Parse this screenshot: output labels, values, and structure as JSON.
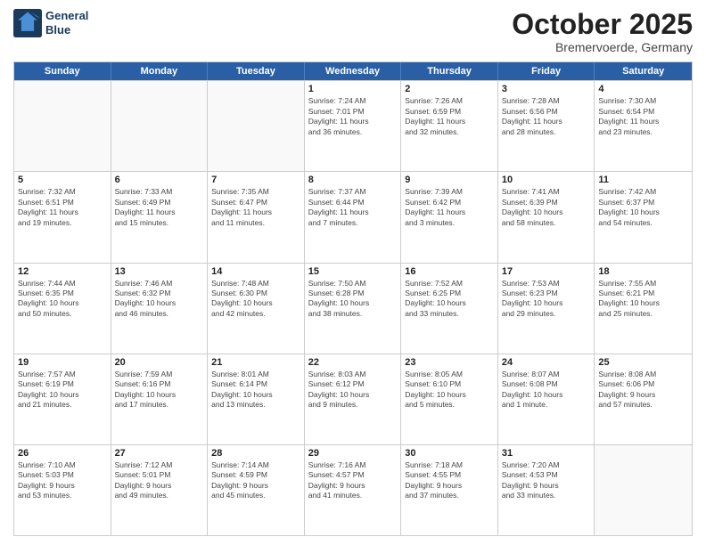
{
  "logo": {
    "line1": "General",
    "line2": "Blue"
  },
  "title": "October 2025",
  "subtitle": "Bremervoerde, Germany",
  "weekdays": [
    "Sunday",
    "Monday",
    "Tuesday",
    "Wednesday",
    "Thursday",
    "Friday",
    "Saturday"
  ],
  "rows": [
    [
      {
        "day": "",
        "info": ""
      },
      {
        "day": "",
        "info": ""
      },
      {
        "day": "",
        "info": ""
      },
      {
        "day": "1",
        "info": "Sunrise: 7:24 AM\nSunset: 7:01 PM\nDaylight: 11 hours\nand 36 minutes."
      },
      {
        "day": "2",
        "info": "Sunrise: 7:26 AM\nSunset: 6:59 PM\nDaylight: 11 hours\nand 32 minutes."
      },
      {
        "day": "3",
        "info": "Sunrise: 7:28 AM\nSunset: 6:56 PM\nDaylight: 11 hours\nand 28 minutes."
      },
      {
        "day": "4",
        "info": "Sunrise: 7:30 AM\nSunset: 6:54 PM\nDaylight: 11 hours\nand 23 minutes."
      }
    ],
    [
      {
        "day": "5",
        "info": "Sunrise: 7:32 AM\nSunset: 6:51 PM\nDaylight: 11 hours\nand 19 minutes."
      },
      {
        "day": "6",
        "info": "Sunrise: 7:33 AM\nSunset: 6:49 PM\nDaylight: 11 hours\nand 15 minutes."
      },
      {
        "day": "7",
        "info": "Sunrise: 7:35 AM\nSunset: 6:47 PM\nDaylight: 11 hours\nand 11 minutes."
      },
      {
        "day": "8",
        "info": "Sunrise: 7:37 AM\nSunset: 6:44 PM\nDaylight: 11 hours\nand 7 minutes."
      },
      {
        "day": "9",
        "info": "Sunrise: 7:39 AM\nSunset: 6:42 PM\nDaylight: 11 hours\nand 3 minutes."
      },
      {
        "day": "10",
        "info": "Sunrise: 7:41 AM\nSunset: 6:39 PM\nDaylight: 10 hours\nand 58 minutes."
      },
      {
        "day": "11",
        "info": "Sunrise: 7:42 AM\nSunset: 6:37 PM\nDaylight: 10 hours\nand 54 minutes."
      }
    ],
    [
      {
        "day": "12",
        "info": "Sunrise: 7:44 AM\nSunset: 6:35 PM\nDaylight: 10 hours\nand 50 minutes."
      },
      {
        "day": "13",
        "info": "Sunrise: 7:46 AM\nSunset: 6:32 PM\nDaylight: 10 hours\nand 46 minutes."
      },
      {
        "day": "14",
        "info": "Sunrise: 7:48 AM\nSunset: 6:30 PM\nDaylight: 10 hours\nand 42 minutes."
      },
      {
        "day": "15",
        "info": "Sunrise: 7:50 AM\nSunset: 6:28 PM\nDaylight: 10 hours\nand 38 minutes."
      },
      {
        "day": "16",
        "info": "Sunrise: 7:52 AM\nSunset: 6:25 PM\nDaylight: 10 hours\nand 33 minutes."
      },
      {
        "day": "17",
        "info": "Sunrise: 7:53 AM\nSunset: 6:23 PM\nDaylight: 10 hours\nand 29 minutes."
      },
      {
        "day": "18",
        "info": "Sunrise: 7:55 AM\nSunset: 6:21 PM\nDaylight: 10 hours\nand 25 minutes."
      }
    ],
    [
      {
        "day": "19",
        "info": "Sunrise: 7:57 AM\nSunset: 6:19 PM\nDaylight: 10 hours\nand 21 minutes."
      },
      {
        "day": "20",
        "info": "Sunrise: 7:59 AM\nSunset: 6:16 PM\nDaylight: 10 hours\nand 17 minutes."
      },
      {
        "day": "21",
        "info": "Sunrise: 8:01 AM\nSunset: 6:14 PM\nDaylight: 10 hours\nand 13 minutes."
      },
      {
        "day": "22",
        "info": "Sunrise: 8:03 AM\nSunset: 6:12 PM\nDaylight: 10 hours\nand 9 minutes."
      },
      {
        "day": "23",
        "info": "Sunrise: 8:05 AM\nSunset: 6:10 PM\nDaylight: 10 hours\nand 5 minutes."
      },
      {
        "day": "24",
        "info": "Sunrise: 8:07 AM\nSunset: 6:08 PM\nDaylight: 10 hours\nand 1 minute."
      },
      {
        "day": "25",
        "info": "Sunrise: 8:08 AM\nSunset: 6:06 PM\nDaylight: 9 hours\nand 57 minutes."
      }
    ],
    [
      {
        "day": "26",
        "info": "Sunrise: 7:10 AM\nSunset: 5:03 PM\nDaylight: 9 hours\nand 53 minutes."
      },
      {
        "day": "27",
        "info": "Sunrise: 7:12 AM\nSunset: 5:01 PM\nDaylight: 9 hours\nand 49 minutes."
      },
      {
        "day": "28",
        "info": "Sunrise: 7:14 AM\nSunset: 4:59 PM\nDaylight: 9 hours\nand 45 minutes."
      },
      {
        "day": "29",
        "info": "Sunrise: 7:16 AM\nSunset: 4:57 PM\nDaylight: 9 hours\nand 41 minutes."
      },
      {
        "day": "30",
        "info": "Sunrise: 7:18 AM\nSunset: 4:55 PM\nDaylight: 9 hours\nand 37 minutes."
      },
      {
        "day": "31",
        "info": "Sunrise: 7:20 AM\nSunset: 4:53 PM\nDaylight: 9 hours\nand 33 minutes."
      },
      {
        "day": "",
        "info": ""
      }
    ]
  ]
}
